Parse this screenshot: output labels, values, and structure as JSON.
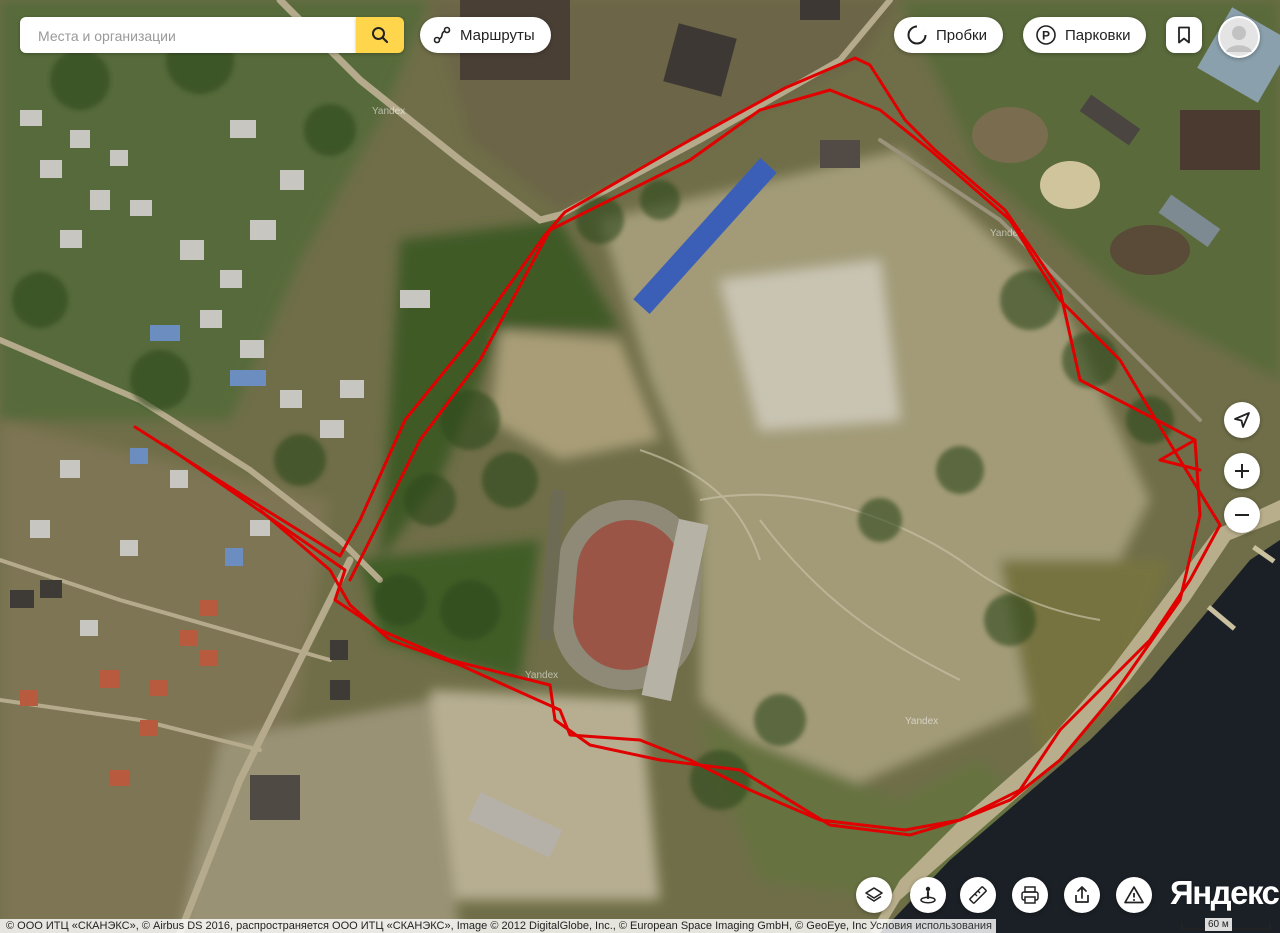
{
  "search": {
    "placeholder": "Места и организации"
  },
  "header": {
    "routes_label": "Маршруты",
    "traffic_label": "Пробки",
    "parking_label": "Парковки"
  },
  "map": {
    "watermark": "Yandex",
    "route_color": "#e00000"
  },
  "scale": {
    "label": "60 м"
  },
  "logo": "Яндекс",
  "copyright": {
    "text": "© ООО ИТЦ «СКАНЭКС», © Airbus DS 2016, распространяется ООО ИТЦ «СКАНЭКС», Image © 2012 DigitalGlobe, Inc., © European Space Imaging GmbH, © GeoEye, Inc",
    "terms": "Условия использования"
  },
  "icons": {
    "search": "search-icon",
    "routes": "routes-icon",
    "traffic": "traffic-icon",
    "parking": "parking-icon",
    "bookmark": "bookmark-icon",
    "avatar": "user-avatar-icon",
    "geolocation": "geolocation-icon",
    "zoom_in": "plus-icon",
    "zoom_out": "minus-icon",
    "layers": "layers-icon",
    "panorama": "panorama-icon",
    "ruler": "ruler-icon",
    "print": "print-icon",
    "share": "share-icon",
    "report": "warning-icon"
  }
}
